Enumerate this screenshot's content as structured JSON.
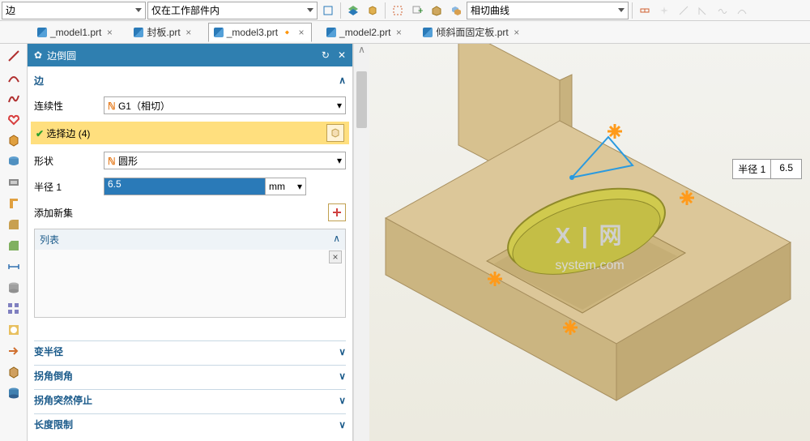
{
  "topbar": {
    "filter1": "边",
    "filter2": "仅在工作部件内",
    "filter3": "相切曲线"
  },
  "tabs": [
    {
      "label": "_model1.prt",
      "active": false,
      "dirty": false
    },
    {
      "label": "封板.prt",
      "active": false,
      "dirty": false
    },
    {
      "label": "_model3.prt",
      "active": true,
      "dirty": true
    },
    {
      "label": "_model2.prt",
      "active": false,
      "dirty": false
    },
    {
      "label": "倾斜面固定板.prt",
      "active": false,
      "dirty": false
    }
  ],
  "panel": {
    "title": "边倒圆",
    "sections": {
      "edge": {
        "label": "边"
      },
      "continuity": {
        "label": "连续性",
        "value": "G1（相切）",
        "icon": "rss"
      },
      "select_edge": {
        "check": "✔",
        "label": "选择边 (4)"
      },
      "shape": {
        "label": "形状",
        "value": "圆形",
        "icon": "rss"
      },
      "radius": {
        "label": "半径 1",
        "value": "6.5",
        "unit": "mm"
      },
      "newset": {
        "label": "添加新集"
      },
      "list": {
        "label": "列表"
      },
      "var_radius": "变半径",
      "corner_chamfer": "拐角倒角",
      "corner_stop": "拐角突然停止",
      "length_limit": "长度限制"
    }
  },
  "callout": {
    "label": "半径 1",
    "value": "6.5"
  },
  "watermark": {
    "main": "X | 网",
    "sub": "system.com"
  }
}
